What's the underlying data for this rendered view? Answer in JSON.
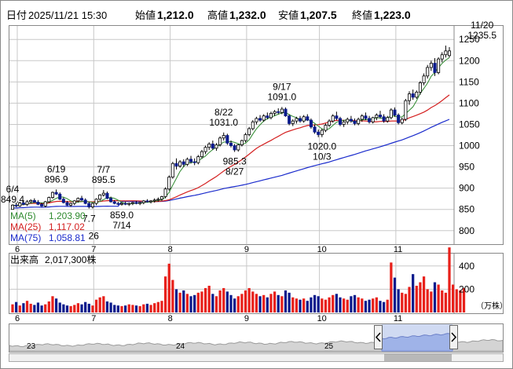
{
  "header": {
    "label_datetime": "日付",
    "datetime": "2025/11/21 15:30",
    "label_open": "始値",
    "open": "1,212.0",
    "label_high": "高値",
    "high": "1,232.0",
    "label_low": "安値",
    "low": "1,207.5",
    "label_close": "終値",
    "close": "1,223.0"
  },
  "colors": {
    "up": "#0a1a8c",
    "down": "#e8201a",
    "ma5": "#2e8a2e",
    "ma25": "#d42020",
    "ma75": "#1a2bcc",
    "grid": "#c8c8c8",
    "high_text": "#cc0000",
    "low_text": "#007a00"
  },
  "legend": {
    "ma5": "MA(5)",
    "ma5_value": "1,203.90",
    "ma25": "MA(25)",
    "ma25_value": "1,117.02",
    "ma75": "MA(75)",
    "ma75_value": "1,058.81"
  },
  "volume": {
    "label": "出来高",
    "value": "2,017,300株",
    "unit": "（万株）"
  },
  "navigator": {
    "year_labels": [
      "23",
      "24",
      "25"
    ],
    "left_handle_icon": "chevron-left-icon",
    "right_handle_icon": "chevron-right-icon"
  },
  "chart_data": {
    "type": "candlestick",
    "price_axis": {
      "ticks": [
        800,
        850,
        900,
        950,
        1000,
        1050,
        1100,
        1150,
        1200,
        1250
      ],
      "range": [
        770,
        1280
      ]
    },
    "volume_axis": {
      "ticks": [
        200,
        400
      ],
      "range": [
        0,
        500
      ]
    },
    "month_labels": [
      {
        "label": "6",
        "index": 0
      },
      {
        "label": "7",
        "index": 21
      },
      {
        "label": "8",
        "index": 42
      },
      {
        "label": "9",
        "index": 63
      },
      {
        "label": "10",
        "index": 83
      },
      {
        "label": "11",
        "index": 104
      }
    ],
    "annotations": [
      {
        "price": "849.4",
        "date": "6/4",
        "index": 0,
        "value": 849.4,
        "position": "above"
      },
      {
        "price": "896.9",
        "date": "6/19",
        "index": 12,
        "value": 896.9,
        "position": "above"
      },
      {
        "price": "895.5",
        "date": "7/7",
        "index": 25,
        "value": 895.5,
        "position": "above"
      },
      {
        "price": "859.0",
        "date": "7/14",
        "index": 30,
        "value": 859.0,
        "position": "below"
      },
      {
        "price": "7.7",
        "date": "",
        "index": 21,
        "value": 850,
        "position": "below"
      },
      {
        "price": "26",
        "date": "",
        "index": 21,
        "value": 850,
        "position": "below2"
      },
      {
        "price": "1031.0",
        "date": "8/22",
        "index": 58,
        "value": 1031.0,
        "position": "above"
      },
      {
        "price": "985.3",
        "date": "8/27",
        "index": 61,
        "value": 985.3,
        "position": "below"
      },
      {
        "price": "1091.0",
        "date": "9/17",
        "index": 74,
        "value": 1091.0,
        "position": "above"
      },
      {
        "price": "1020.0",
        "date": "10/3",
        "index": 85,
        "value": 1020.0,
        "position": "below"
      },
      {
        "price": "1235.5",
        "date": "11/20",
        "index": 129,
        "value": 1235.5,
        "position": "above"
      }
    ],
    "candles": [
      [
        850,
        862,
        849.4,
        860
      ],
      [
        860,
        866,
        855,
        858
      ],
      [
        858,
        868,
        856,
        865
      ],
      [
        865,
        870,
        860,
        862
      ],
      [
        862,
        872,
        858,
        868
      ],
      [
        868,
        874,
        864,
        871
      ],
      [
        871,
        876,
        866,
        867
      ],
      [
        867,
        872,
        860,
        862
      ],
      [
        862,
        866,
        856,
        858
      ],
      [
        858,
        870,
        855,
        868
      ],
      [
        868,
        880,
        866,
        878
      ],
      [
        878,
        892,
        875,
        890
      ],
      [
        890,
        896.9,
        884,
        886
      ],
      [
        886,
        890,
        872,
        874
      ],
      [
        874,
        878,
        864,
        866
      ],
      [
        866,
        870,
        858,
        860
      ],
      [
        860,
        866,
        856,
        864
      ],
      [
        864,
        872,
        860,
        870
      ],
      [
        870,
        878,
        866,
        876
      ],
      [
        876,
        882,
        870,
        872
      ],
      [
        872,
        876,
        862,
        864
      ],
      [
        864,
        868,
        852,
        856
      ],
      [
        856,
        866,
        852,
        864
      ],
      [
        864,
        876,
        860,
        874
      ],
      [
        874,
        886,
        870,
        884
      ],
      [
        884,
        895.5,
        880,
        888
      ],
      [
        888,
        892,
        874,
        876
      ],
      [
        876,
        880,
        866,
        868
      ],
      [
        868,
        872,
        862,
        864
      ],
      [
        864,
        868,
        860,
        862
      ],
      [
        862,
        866,
        859,
        864
      ],
      [
        864,
        868,
        860,
        862
      ],
      [
        862,
        866,
        858,
        864
      ],
      [
        864,
        868,
        860,
        866
      ],
      [
        866,
        870,
        862,
        864
      ],
      [
        864,
        868,
        860,
        866
      ],
      [
        866,
        872,
        862,
        870
      ],
      [
        870,
        874,
        866,
        868
      ],
      [
        868,
        872,
        864,
        870
      ],
      [
        870,
        876,
        866,
        872
      ],
      [
        872,
        878,
        868,
        874
      ],
      [
        874,
        882,
        870,
        880
      ],
      [
        880,
        902,
        876,
        898
      ],
      [
        898,
        930,
        894,
        926
      ],
      [
        926,
        962,
        922,
        958
      ],
      [
        958,
        970,
        944,
        952
      ],
      [
        952,
        966,
        948,
        962
      ],
      [
        962,
        968,
        950,
        956
      ],
      [
        956,
        972,
        952,
        968
      ],
      [
        968,
        976,
        958,
        962
      ],
      [
        962,
        970,
        954,
        960
      ],
      [
        960,
        978,
        956,
        974
      ],
      [
        974,
        990,
        970,
        986
      ],
      [
        986,
        1000,
        980,
        996
      ],
      [
        996,
        1008,
        990,
        1004
      ],
      [
        1004,
        1012,
        990,
        994
      ],
      [
        994,
        1006,
        988,
        1002
      ],
      [
        1002,
        1022,
        998,
        1018
      ],
      [
        1018,
        1031,
        1012,
        1024
      ],
      [
        1024,
        1028,
        1002,
        1006
      ],
      [
        1006,
        1012,
        996,
        1000
      ],
      [
        1000,
        1004,
        985.3,
        990
      ],
      [
        990,
        1004,
        986,
        1002
      ],
      [
        1002,
        1014,
        998,
        1012
      ],
      [
        1012,
        1030,
        1008,
        1026
      ],
      [
        1026,
        1044,
        1022,
        1040
      ],
      [
        1040,
        1060,
        1036,
        1056
      ],
      [
        1056,
        1068,
        1050,
        1064
      ],
      [
        1064,
        1072,
        1056,
        1060
      ],
      [
        1060,
        1074,
        1056,
        1070
      ],
      [
        1070,
        1078,
        1062,
        1066
      ],
      [
        1066,
        1080,
        1062,
        1076
      ],
      [
        1076,
        1084,
        1070,
        1080
      ],
      [
        1080,
        1088,
        1074,
        1078
      ],
      [
        1078,
        1091,
        1074,
        1086
      ],
      [
        1086,
        1090,
        1068,
        1070
      ],
      [
        1070,
        1074,
        1048,
        1052
      ],
      [
        1052,
        1062,
        1046,
        1058
      ],
      [
        1058,
        1068,
        1052,
        1064
      ],
      [
        1064,
        1070,
        1054,
        1058
      ],
      [
        1058,
        1072,
        1054,
        1068
      ],
      [
        1068,
        1074,
        1058,
        1060
      ],
      [
        1060,
        1064,
        1040,
        1044
      ],
      [
        1044,
        1050,
        1028,
        1032
      ],
      [
        1032,
        1038,
        1020,
        1026
      ],
      [
        1026,
        1040,
        1020,
        1036
      ],
      [
        1036,
        1052,
        1032,
        1048
      ],
      [
        1048,
        1062,
        1044,
        1058
      ],
      [
        1058,
        1074,
        1054,
        1070
      ],
      [
        1070,
        1080,
        1060,
        1064
      ],
      [
        1064,
        1068,
        1046,
        1050
      ],
      [
        1050,
        1060,
        1044,
        1056
      ],
      [
        1056,
        1066,
        1050,
        1062
      ],
      [
        1062,
        1070,
        1054,
        1058
      ],
      [
        1058,
        1064,
        1048,
        1052
      ],
      [
        1052,
        1066,
        1048,
        1062
      ],
      [
        1062,
        1074,
        1056,
        1070
      ],
      [
        1070,
        1078,
        1060,
        1064
      ],
      [
        1064,
        1070,
        1052,
        1056
      ],
      [
        1056,
        1068,
        1052,
        1066
      ],
      [
        1066,
        1076,
        1060,
        1072
      ],
      [
        1072,
        1082,
        1064,
        1068
      ],
      [
        1068,
        1074,
        1054,
        1058
      ],
      [
        1058,
        1070,
        1054,
        1066
      ],
      [
        1066,
        1088,
        1062,
        1084
      ],
      [
        1084,
        1090,
        1068,
        1072
      ],
      [
        1072,
        1076,
        1050,
        1054
      ],
      [
        1054,
        1066,
        1050,
        1062
      ],
      [
        1062,
        1110,
        1058,
        1106
      ],
      [
        1106,
        1128,
        1096,
        1122
      ],
      [
        1122,
        1132,
        1108,
        1114
      ],
      [
        1114,
        1130,
        1110,
        1126
      ],
      [
        1126,
        1152,
        1120,
        1148
      ],
      [
        1148,
        1170,
        1142,
        1164
      ],
      [
        1164,
        1190,
        1158,
        1184
      ],
      [
        1184,
        1200,
        1176,
        1194
      ],
      [
        1194,
        1206,
        1164,
        1172
      ],
      [
        1172,
        1208,
        1168,
        1204
      ],
      [
        1204,
        1220,
        1196,
        1214
      ],
      [
        1214,
        1235.5,
        1207.5,
        1223
      ],
      [
        1212,
        1232,
        1207.5,
        1223
      ]
    ],
    "volumes": [
      70,
      90,
      60,
      80,
      100,
      75,
      65,
      85,
      60,
      70,
      95,
      140,
      120,
      85,
      70,
      60,
      55,
      65,
      80,
      70,
      90,
      75,
      60,
      110,
      130,
      140,
      95,
      85,
      65,
      60,
      55,
      60,
      70,
      65,
      60,
      55,
      70,
      75,
      65,
      80,
      90,
      100,
      310,
      420,
      280,
      200,
      170,
      190,
      160,
      140,
      150,
      170,
      180,
      210,
      230,
      160,
      140,
      190,
      210,
      180,
      150,
      120,
      140,
      160,
      190,
      210,
      180,
      160,
      140,
      150,
      130,
      160,
      180,
      150,
      140,
      190,
      170,
      130,
      120,
      110,
      120,
      100,
      130,
      150,
      140,
      120,
      110,
      130,
      150,
      160,
      130,
      120,
      110,
      140,
      150,
      130,
      120,
      100,
      110,
      120,
      130,
      100,
      90,
      110,
      430,
      300,
      200,
      170,
      160,
      220,
      330,
      230,
      260,
      310,
      200,
      180,
      260,
      240,
      190,
      170,
      560,
      240,
      200,
      190,
      210
    ]
  }
}
